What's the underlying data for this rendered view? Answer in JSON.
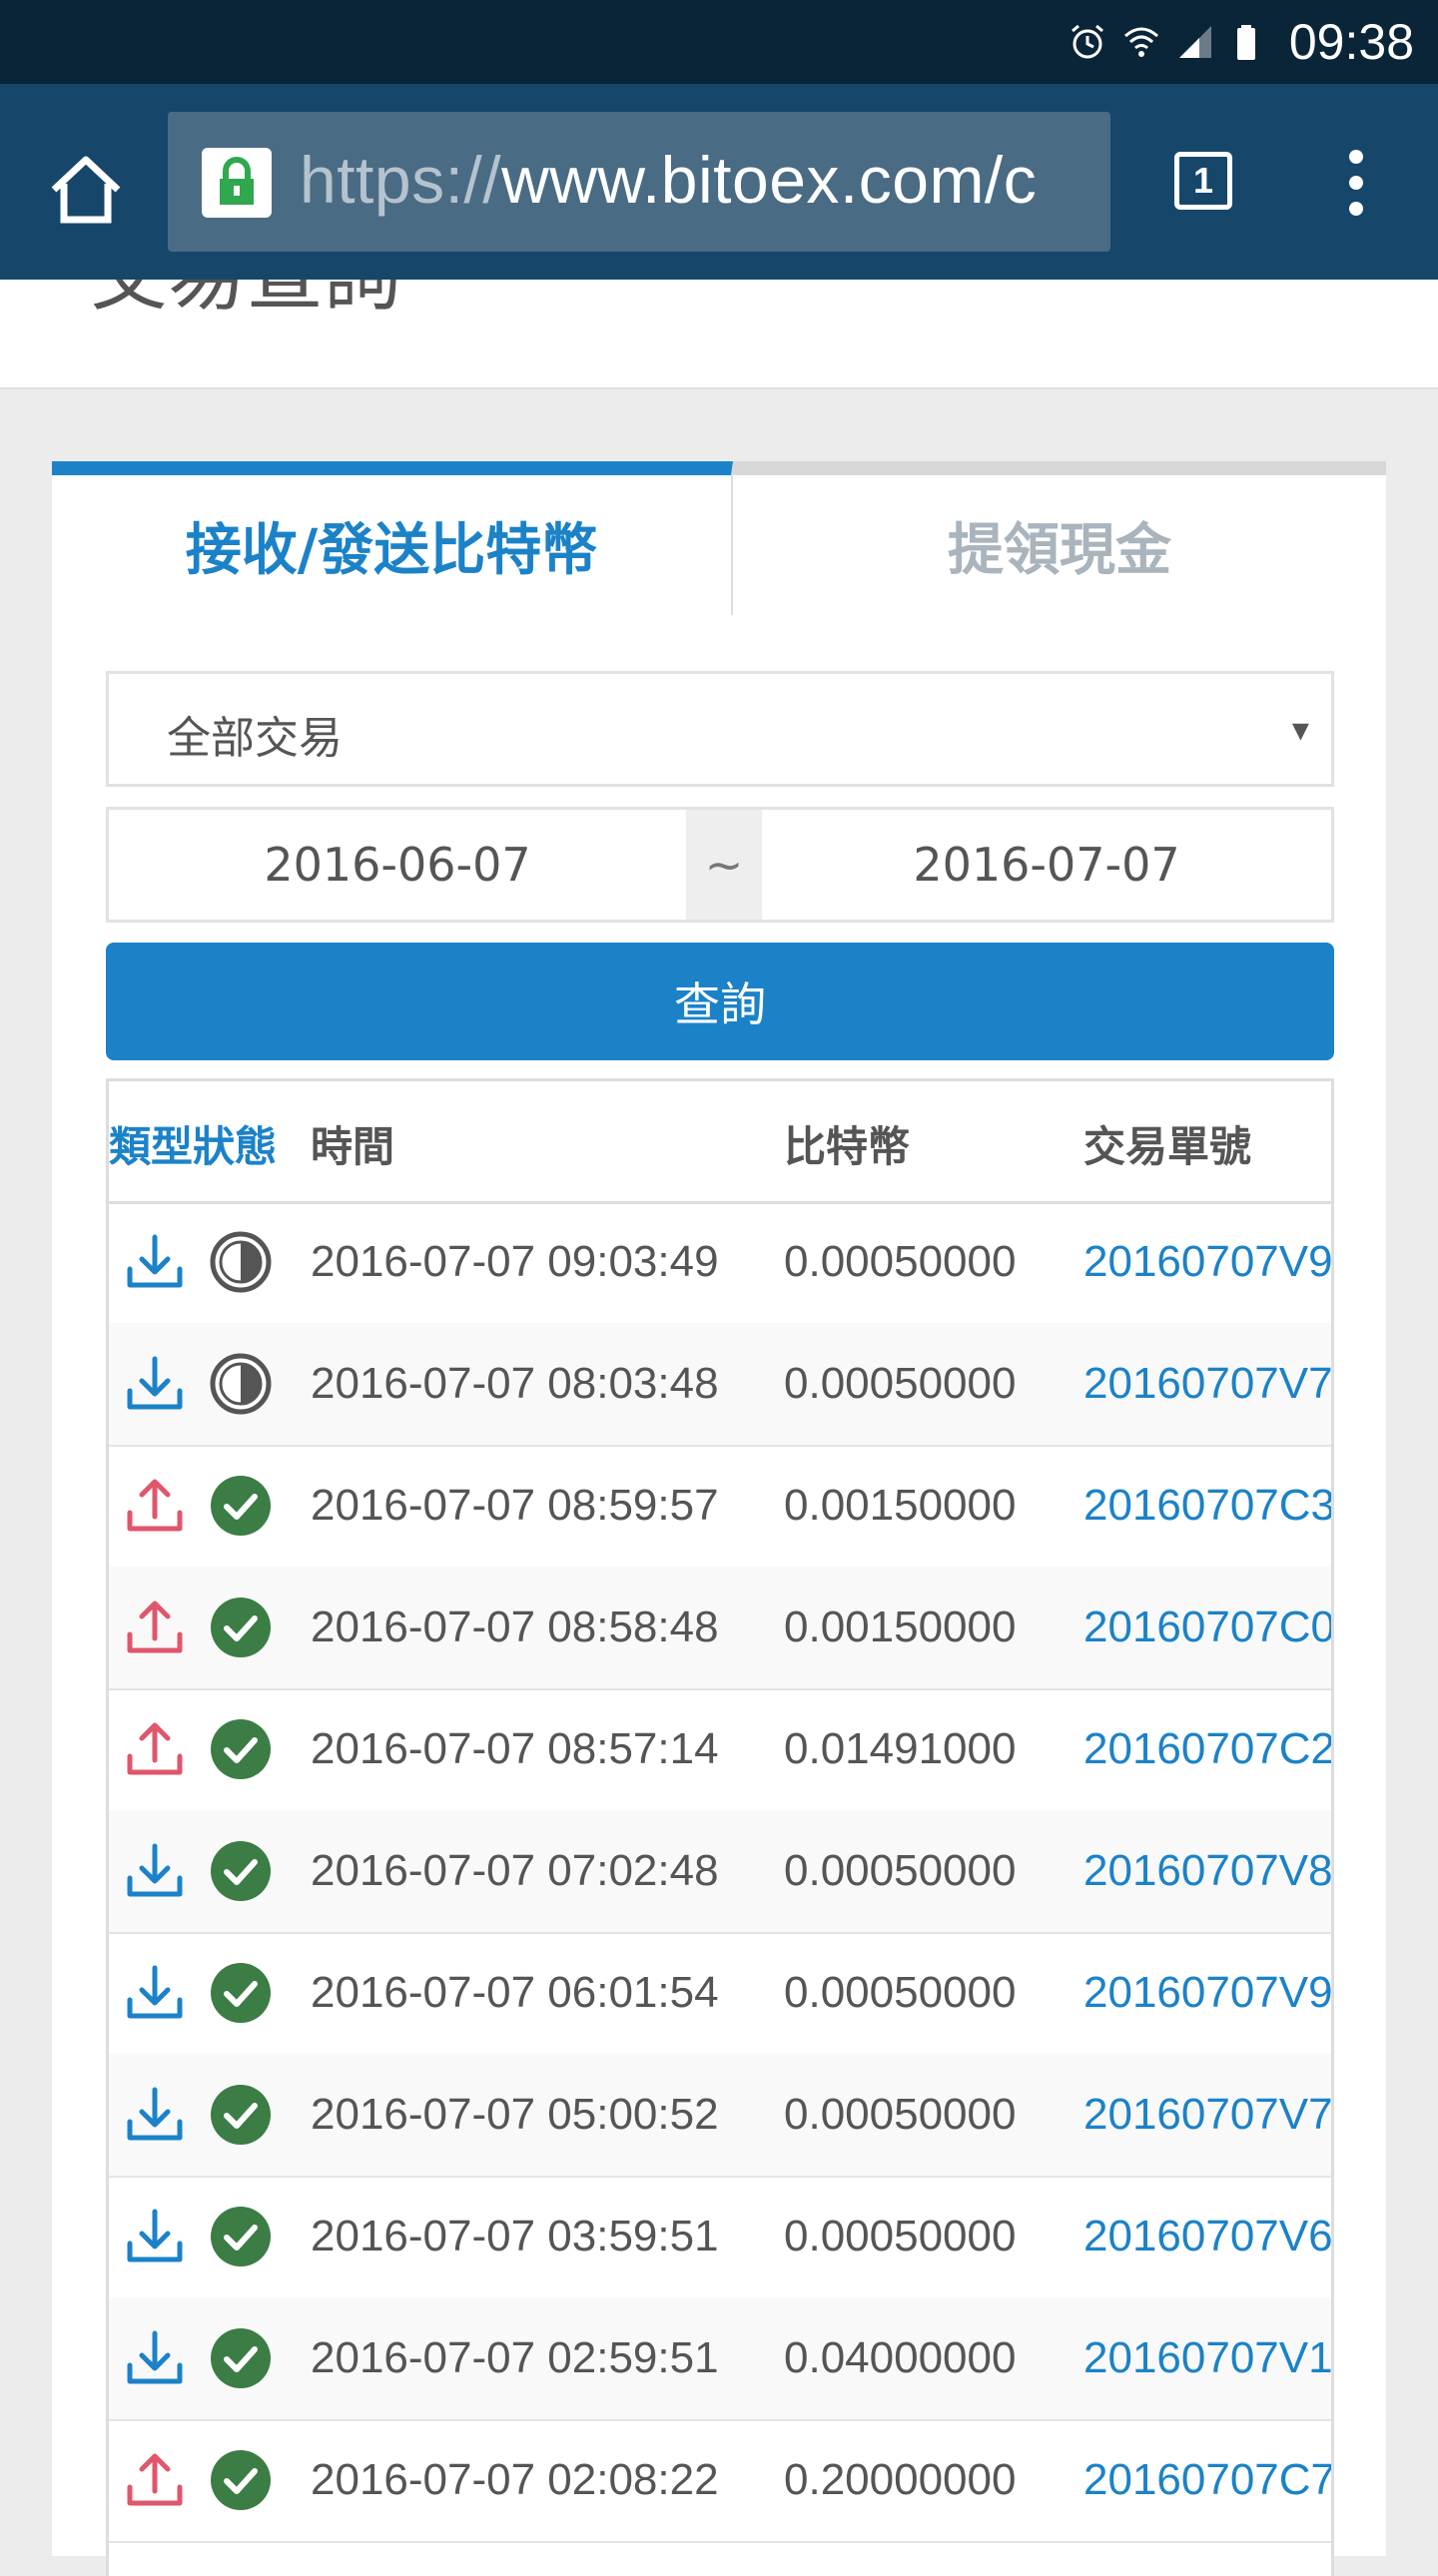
{
  "status_bar": {
    "time": "09:38"
  },
  "browser": {
    "url_scheme": "https://",
    "url_host": "www.bitoex.com/c",
    "tab_count": "1"
  },
  "page": {
    "title": "交易查詢"
  },
  "tabs": [
    {
      "label": "接收/發送比特幣",
      "active": true
    },
    {
      "label": "提領現金",
      "active": false
    }
  ],
  "filter": {
    "selected": "全部交易",
    "caret": "▾"
  },
  "date_range": {
    "from": "2016-06-07",
    "separator": "~",
    "to": "2016-07-07"
  },
  "query_button": "查詢",
  "table": {
    "headers": {
      "type_status": "類型狀態",
      "time": "時間",
      "btc": "比特幣",
      "tx_id": "交易單號"
    },
    "rows": [
      {
        "direction": "receive",
        "status": "pending",
        "time": "2016-07-07 09:03:49",
        "btc": "0.00050000",
        "tx_id": "20160707V9"
      },
      {
        "direction": "receive",
        "status": "pending",
        "time": "2016-07-07 08:03:48",
        "btc": "0.00050000",
        "tx_id": "20160707V7"
      },
      {
        "direction": "send",
        "status": "complete",
        "time": "2016-07-07 08:59:57",
        "btc": "0.00150000",
        "tx_id": "20160707C3"
      },
      {
        "direction": "send",
        "status": "complete",
        "time": "2016-07-07 08:58:48",
        "btc": "0.00150000",
        "tx_id": "20160707C0"
      },
      {
        "direction": "send",
        "status": "complete",
        "time": "2016-07-07 08:57:14",
        "btc": "0.01491000",
        "tx_id": "20160707C2"
      },
      {
        "direction": "receive",
        "status": "complete",
        "time": "2016-07-07 07:02:48",
        "btc": "0.00050000",
        "tx_id": "20160707V8"
      },
      {
        "direction": "receive",
        "status": "complete",
        "time": "2016-07-07 06:01:54",
        "btc": "0.00050000",
        "tx_id": "20160707V9"
      },
      {
        "direction": "receive",
        "status": "complete",
        "time": "2016-07-07 05:00:52",
        "btc": "0.00050000",
        "tx_id": "20160707V7"
      },
      {
        "direction": "receive",
        "status": "complete",
        "time": "2016-07-07 03:59:51",
        "btc": "0.00050000",
        "tx_id": "20160707V6"
      },
      {
        "direction": "receive",
        "status": "complete",
        "time": "2016-07-07 02:59:51",
        "btc": "0.04000000",
        "tx_id": "20160707V1"
      },
      {
        "direction": "send",
        "status": "complete",
        "time": "2016-07-07 02:08:22",
        "btc": "0.20000000",
        "tx_id": "20160707C7"
      }
    ]
  },
  "colors": {
    "accent": "#1b82c8",
    "toolbar": "#16476a",
    "statusbar": "#0b2538",
    "send": "#e0566b",
    "receive": "#1b82c8",
    "complete": "#3b7d45",
    "pending": "#555555"
  },
  "icons": {
    "receive": "download-icon",
    "send": "upload-icon",
    "pending": "half-circle-icon",
    "complete": "check-circle-icon"
  }
}
